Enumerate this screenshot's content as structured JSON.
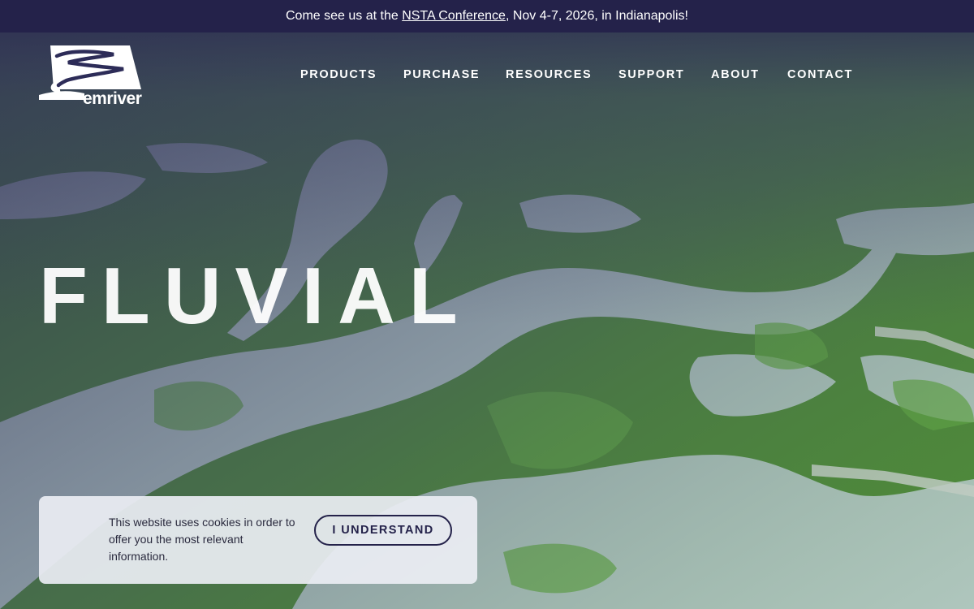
{
  "announcement": {
    "prefix": "Come see us at the ",
    "link_text": "NSTA Conference",
    "suffix": ", Nov 4-7, 2026, in Indianapolis!"
  },
  "brand": {
    "name": "emriver"
  },
  "nav": {
    "items": [
      {
        "label": "PRODUCTS"
      },
      {
        "label": "PURCHASE"
      },
      {
        "label": "RESOURCES"
      },
      {
        "label": "SUPPORT"
      },
      {
        "label": "ABOUT"
      },
      {
        "label": "CONTACT"
      }
    ]
  },
  "hero": {
    "title": "FLUVIAL"
  },
  "cookie": {
    "message": "This website uses cookies in order to offer you the most relevant information.",
    "button_label": "I UNDERSTAND"
  },
  "colors": {
    "navy": "#24224a",
    "water": "#b8ccc6",
    "marsh": "#5a9a3a",
    "white": "#ffffff"
  },
  "icons": {
    "logo": "river-meander-logo-icon"
  }
}
